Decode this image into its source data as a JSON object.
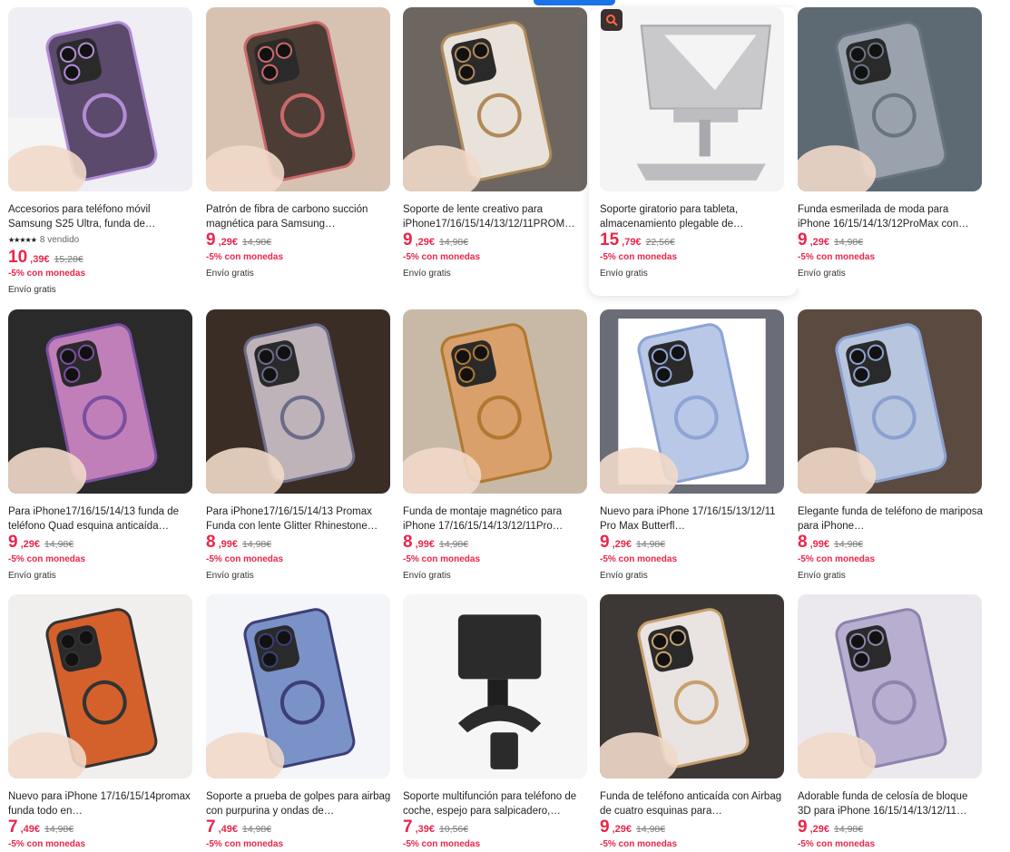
{
  "products": [
    {
      "title": "Accesorios para teléfono móvil Samsung S25 Ultra, funda de…",
      "price_int": "10",
      "price_dec": ",39€",
      "old_price": "15,28€",
      "promo": "-5% con monedas",
      "shipping": "Envío gratis",
      "rating_stars": "★★★★★",
      "sold": "8 vendido",
      "img": "s25"
    },
    {
      "title": "Patrón de fibra de carbono succión magnética para Samsung…",
      "price_int": "9",
      "price_dec": ",29€",
      "old_price": "14,98€",
      "promo": "-5% con monedas",
      "shipping": "Envío gratis",
      "img": "carbon"
    },
    {
      "title": "Soporte de lente creativo para iPhone17/16/15/14/13/12/11PROM…",
      "price_int": "9",
      "price_dec": ",29€",
      "old_price": "14,98€",
      "promo": "-5% con monedas",
      "shipping": "Envío gratis",
      "img": "gold"
    },
    {
      "title": "Soporte giratorio para tableta, almacenamiento plegable de…",
      "price_int": "15",
      "price_dec": ",79€",
      "old_price": "22,56€",
      "promo": "-5% con monedas",
      "shipping": "Envío gratis",
      "img": "stand"
    },
    {
      "title": "Funda esmerilada de moda para iPhone 16/15/14/13/12ProMax con…",
      "price_int": "9",
      "price_dec": ",29€",
      "old_price": "14,98€",
      "promo": "-5% con monedas",
      "shipping": "Envío gratis",
      "img": "frosted"
    },
    {
      "title": "Para iPhone17/16/15/14/13 funda de teléfono Quad esquina anticaída…",
      "price_int": "9",
      "price_dec": ",29€",
      "old_price": "14,98€",
      "promo": "-5% con monedas",
      "shipping": "Envío gratis",
      "img": "glitter"
    },
    {
      "title": "Para iPhone17/16/15/14/13 Promax Funda con lente Glitter Rhinestone…",
      "price_int": "8",
      "price_dec": ",99€",
      "old_price": "14,98€",
      "promo": "-5% con monedas",
      "shipping": "Envío gratis",
      "img": "peacock"
    },
    {
      "title": "Funda de montaje magnético para iPhone 17/16/15/14/13/12/11Pro…",
      "price_int": "8",
      "price_dec": ",99€",
      "old_price": "14,98€",
      "promo": "-5% con monedas",
      "shipping": "Envío gratis",
      "img": "orange"
    },
    {
      "title": "Nuevo para iPhone 17/16/15/13/12/11 Pro Max Butterfl…",
      "price_int": "9",
      "price_dec": ",29€",
      "old_price": "14,98€",
      "promo": "-5% con monedas",
      "shipping": "Envío gratis",
      "img": "butterfly"
    },
    {
      "title": "Elegante funda de teléfono de mariposa para iPhone…",
      "price_int": "8",
      "price_dec": ",99€",
      "old_price": "14,98€",
      "promo": "-5% con monedas",
      "shipping": "Envío gratis",
      "img": "fan"
    },
    {
      "title": "Nuevo para iPhone 17/16/15/14promax funda todo en…",
      "price_int": "7",
      "price_dec": ",49€",
      "old_price": "14,98€",
      "promo": "-5% con monedas",
      "shipping": "",
      "img": "flip"
    },
    {
      "title": "Soporte a prueba de golpes para airbag con purpurina y ondas de…",
      "price_int": "7",
      "price_dec": ",49€",
      "old_price": "14,98€",
      "promo": "-5% con monedas",
      "shipping": "",
      "img": "bluewave"
    },
    {
      "title": "Soporte multifunción para teléfono de coche, espejo para salpicadero,…",
      "price_int": "7",
      "price_dec": ",39€",
      "old_price": "10,56€",
      "promo": "-5% con monedas",
      "shipping": "",
      "img": "clip"
    },
    {
      "title": "Funda de teléfono anticaída con Airbag de cuatro esquinas para…",
      "price_int": "9",
      "price_dec": ",29€",
      "old_price": "14,98€",
      "promo": "-5% con monedas",
      "shipping": "",
      "img": "ringcase"
    },
    {
      "title": "Adorable funda de celosía de bloque 3D para iPhone 16/15/14/13/12/11…",
      "price_int": "9",
      "price_dec": ",29€",
      "old_price": "14,98€",
      "promo": "-5% con monedas",
      "shipping": "",
      "img": "bubble"
    }
  ],
  "colors": {
    "price": "#e8264a",
    "accent": "#1a73e8"
  },
  "icons": {
    "visual_search": "visual-search-icon"
  }
}
